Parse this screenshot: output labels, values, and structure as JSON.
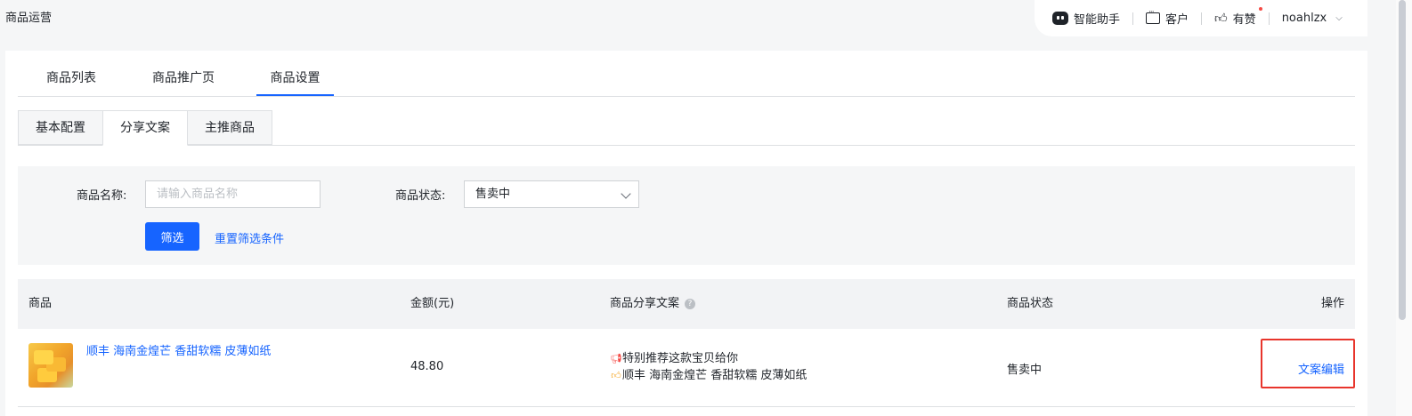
{
  "page": {
    "title": "商品运营"
  },
  "topbar": {
    "assistant_label": "智能助手",
    "service_label": "客户",
    "like_label": "有赞",
    "username": "noahlzx"
  },
  "main_tabs": [
    {
      "label": "商品列表"
    },
    {
      "label": "商品推广页"
    },
    {
      "label": "商品设置",
      "active": true
    }
  ],
  "sub_tabs": [
    {
      "label": "基本配置"
    },
    {
      "label": "分享文案",
      "active": true
    },
    {
      "label": "主推商品"
    }
  ],
  "filter": {
    "name_label": "商品名称:",
    "name_placeholder": "请输入商品名称",
    "name_value": "",
    "status_label": "商品状态:",
    "status_value": "售卖中",
    "submit_label": "筛选",
    "reset_label": "重置筛选条件"
  },
  "table": {
    "headers": {
      "product": "商品",
      "amount": "金额(元)",
      "share_copy": "商品分享文案",
      "status": "商品状态",
      "action": "操作"
    },
    "rows": [
      {
        "name": "顺丰 海南金煌芒 香甜软糯 皮薄如纸",
        "amount": "48.80",
        "copy_line1": "特别推荐这款宝贝给你",
        "copy_line2": "顺丰 海南金煌芒 香甜软糯 皮薄如纸",
        "status": "售卖中",
        "action": "文案编辑"
      }
    ]
  },
  "colors": {
    "accent": "#1664ff",
    "highlight_border": "#e8352c"
  },
  "icons": [
    "robot-icon",
    "customer-service-icon",
    "thumbs-up-icon",
    "chevron-down-icon",
    "help-icon",
    "megaphone-icon",
    "thumbs-up-emoji-icon"
  ]
}
